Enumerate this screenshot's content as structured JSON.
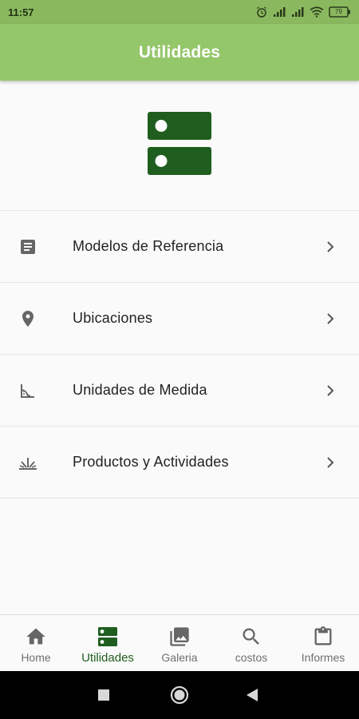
{
  "status_bar": {
    "time": "11:57",
    "battery_level": "79"
  },
  "header": {
    "title": "Utilidades"
  },
  "colors": {
    "status_bar": "#8ab85f",
    "app_bar": "#94c66a",
    "primary_dark_green": "#1f5e1f",
    "icon_gray": "#666666",
    "text_gray": "#6f6f6f"
  },
  "hero": {
    "icon": "storage-icon"
  },
  "menu": {
    "items": [
      {
        "label": "Modelos de Referencia",
        "icon": "document-icon"
      },
      {
        "label": "Ubicaciones",
        "icon": "location-pin-icon"
      },
      {
        "label": "Unidades de Medida",
        "icon": "measure-angle-icon"
      },
      {
        "label": "Productos y Actividades",
        "icon": "grass-icon"
      }
    ]
  },
  "bottom_nav": {
    "items": [
      {
        "label": "Home",
        "icon": "home-icon",
        "active": false
      },
      {
        "label": "Utilidades",
        "icon": "storage-icon",
        "active": true
      },
      {
        "label": "Galeria",
        "icon": "gallery-icon",
        "active": false
      },
      {
        "label": "costos",
        "icon": "search-icon",
        "active": false
      },
      {
        "label": "Informes",
        "icon": "clipboard-icon",
        "active": false
      }
    ]
  },
  "system_nav": {
    "buttons": [
      "recents-square-icon",
      "home-circle-icon",
      "back-triangle-icon"
    ]
  }
}
